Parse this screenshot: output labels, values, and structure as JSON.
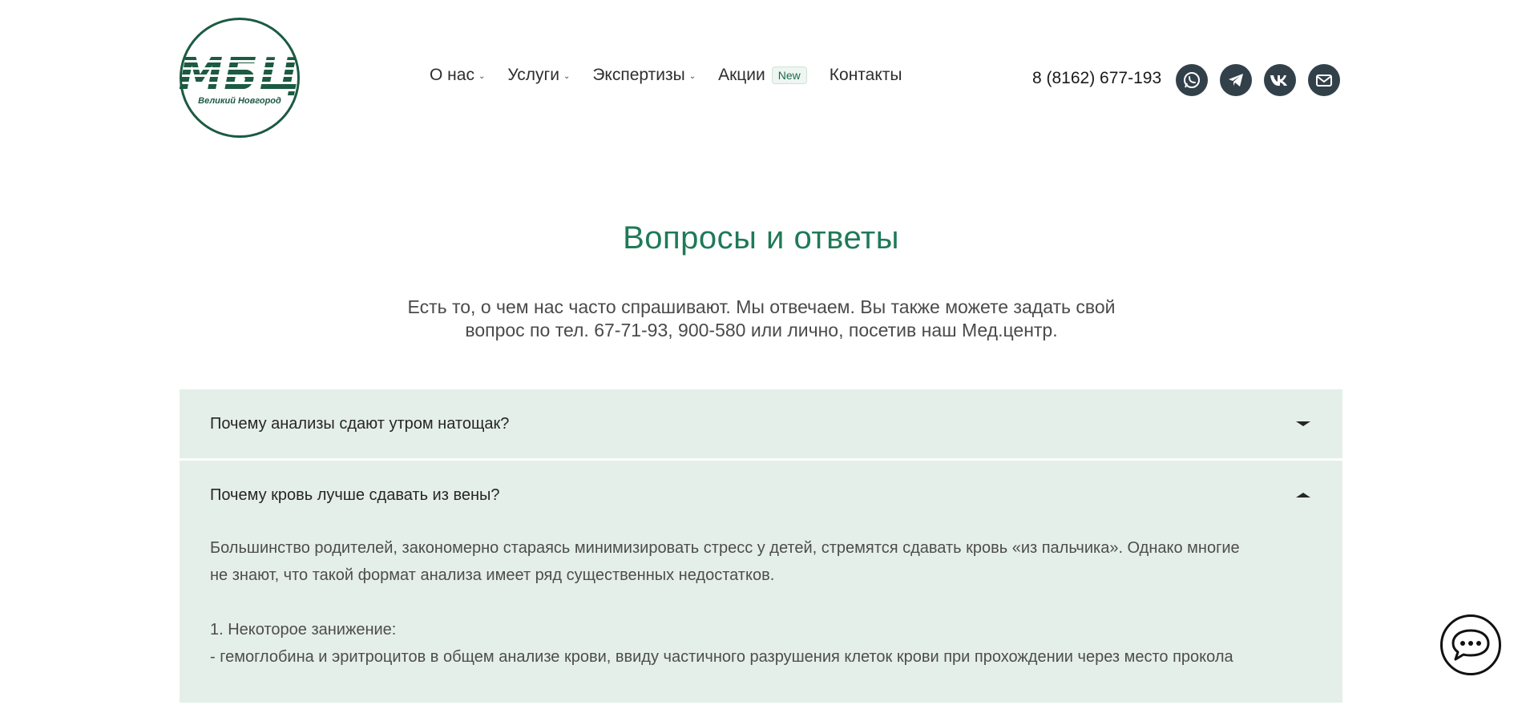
{
  "header": {
    "logo": {
      "mark": "МБЦ",
      "city": "Великий Новгород"
    },
    "nav": [
      {
        "label": "О нас",
        "has_dropdown": true
      },
      {
        "label": "Услуги",
        "has_dropdown": true
      },
      {
        "label": "Экспертизы",
        "has_dropdown": true
      },
      {
        "label": "Акции",
        "badge": "New"
      },
      {
        "label": "Контакты"
      }
    ],
    "phone": "8 (8162) 677-193",
    "socials": [
      "whatsapp-icon",
      "telegram-icon",
      "vk-icon",
      "mail-icon"
    ]
  },
  "main": {
    "title": "Вопросы и ответы",
    "subtitle_line1": "Есть то, о чем нас часто спрашивают. Мы отвечаем. Вы также можете задать свой",
    "subtitle_line2": "вопрос по тел. 67-71-93, 900-580 или лично, посетив наш Мед.центр.",
    "faq": [
      {
        "question": "Почему анализы сдают утром натощак?",
        "expanded": false
      },
      {
        "question": "Почему кровь лучше сдавать из вены?",
        "expanded": true,
        "answer_p1_l1": "Большинство родителей, закономерно стараясь минимизировать стресс у детей, стремятся сдавать кровь «из пальчика». Однако многие",
        "answer_p1_l2": "не знают, что такой формат анализа имеет ряд существенных недостатков.",
        "answer_p2": "1. Некоторое занижение:",
        "answer_p3": "- гемоглобина и эритроцитов в общем анализе крови, ввиду частичного разрушения клеток крови при прохождении через место прокола"
      }
    ]
  },
  "colors": {
    "brand_green": "#1c5a42",
    "title_green": "#1f7a58",
    "accordion_bg": "#e5efea",
    "social_bg": "#32404a"
  }
}
